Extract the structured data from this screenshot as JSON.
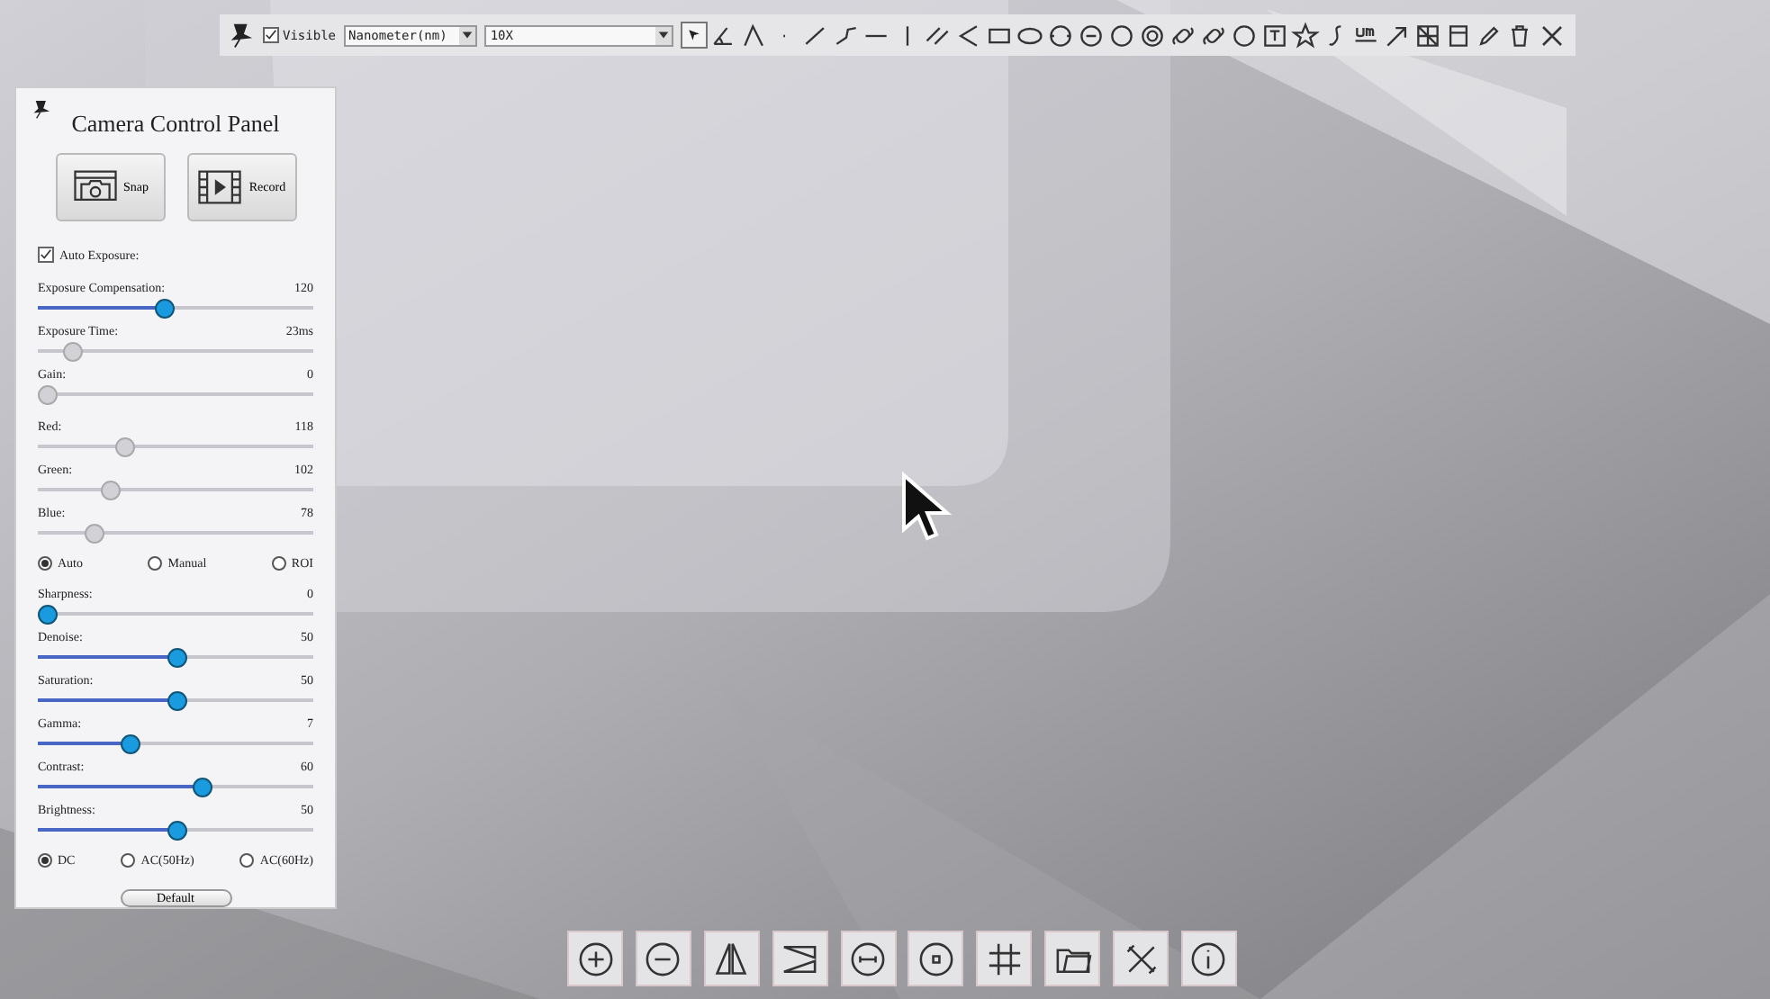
{
  "toolbar": {
    "visible": {
      "label": "Visible",
      "checked": true
    },
    "unit_select": "Nanometer(nm)",
    "magnification_select": "10X"
  },
  "panel": {
    "title": "Camera Control Panel",
    "snap_button": "Snap",
    "record_button": "Record",
    "auto_exposure": {
      "label": "Auto Exposure:",
      "checked": true
    },
    "exposure_sliders": [
      {
        "label": "Exposure Compensation:",
        "value": "120",
        "level": 0.45,
        "disabled": false
      },
      {
        "label": "Exposure Time:",
        "value": "23ms",
        "level": 0.1,
        "disabled": true
      },
      {
        "label": "Gain:",
        "value": "0",
        "level": 0,
        "disabled": true
      }
    ],
    "color_sliders": [
      {
        "label": "Red:",
        "value": "118",
        "level": 0.3,
        "disabled": true
      },
      {
        "label": "Green:",
        "value": "102",
        "level": 0.24,
        "disabled": true
      },
      {
        "label": "Blue:",
        "value": "78",
        "level": 0.18,
        "disabled": true
      }
    ],
    "white_balance": [
      {
        "label": "Auto",
        "selected": true
      },
      {
        "label": "Manual",
        "selected": false
      },
      {
        "label": "ROI",
        "selected": false
      }
    ],
    "image_sliders": [
      {
        "label": "Sharpness:",
        "value": "0",
        "level": 0,
        "disabled": false
      },
      {
        "label": "Denoise:",
        "value": "50",
        "level": 0.5,
        "disabled": false
      },
      {
        "label": "Saturation:",
        "value": "50",
        "level": 0.5,
        "disabled": false
      },
      {
        "label": "Gamma:",
        "value": "7",
        "level": 0.32,
        "disabled": false
      },
      {
        "label": "Contrast:",
        "value": "60",
        "level": 0.6,
        "disabled": false
      },
      {
        "label": "Brightness:",
        "value": "50",
        "level": 0.5,
        "disabled": false
      }
    ],
    "power_frequency": [
      {
        "label": "DC",
        "selected": true
      },
      {
        "label": "AC(50Hz)",
        "selected": false
      },
      {
        "label": "AC(60Hz)",
        "selected": false
      }
    ],
    "default_button": "Default"
  }
}
